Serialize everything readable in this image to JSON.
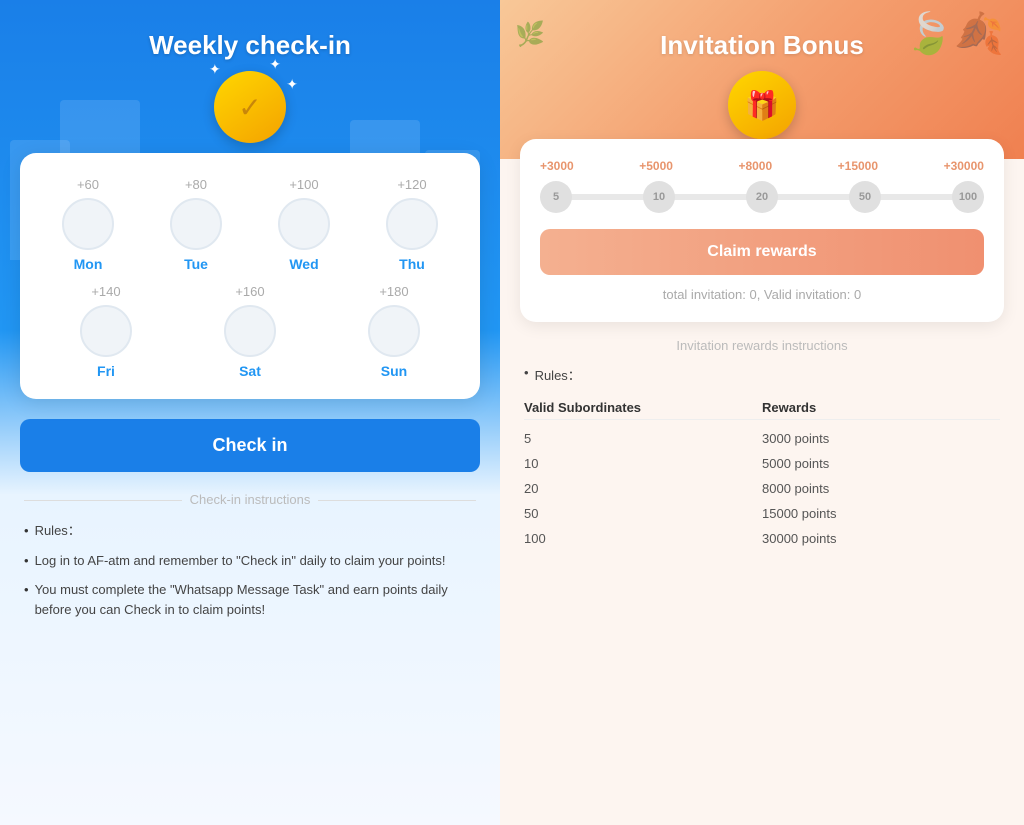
{
  "left": {
    "title": "Weekly check-in",
    "coin_icon": "calendar-check",
    "days": [
      {
        "points": "+60",
        "label": "Mon"
      },
      {
        "points": "+80",
        "label": "Tue"
      },
      {
        "points": "+100",
        "label": "Wed"
      },
      {
        "points": "+120",
        "label": "Thu"
      },
      {
        "points": "+140",
        "label": "Fri"
      },
      {
        "points": "+160",
        "label": "Sat"
      },
      {
        "points": "+180",
        "label": "Sun"
      }
    ],
    "checkin_button": "Check in",
    "instructions_title": "Check-in instructions",
    "rules": [
      "Rules：",
      "Log in to AF-atm and remember to \"Check in\" daily to claim your points!",
      "You must complete the \"Whatsapp Message Task\" and earn points daily before you can Check in to claim points!"
    ]
  },
  "right": {
    "title": "Invitation Bonus",
    "progress_labels": [
      "+3000",
      "+5000",
      "+8000",
      "+15000",
      "+30000"
    ],
    "progress_dots": [
      "5",
      "10",
      "20",
      "50",
      "100"
    ],
    "claim_button": "Claim rewards",
    "stats": "total invitation: 0, Valid invitation: 0",
    "instructions_title": "Invitation rewards instructions",
    "rules": [
      "Rules："
    ],
    "table_header": [
      "Valid Subordinates",
      "Rewards"
    ],
    "table_rows": [
      [
        "5",
        "3000 points"
      ],
      [
        "10",
        "5000 points"
      ],
      [
        "20",
        "8000 points"
      ],
      [
        "50",
        "15000 points"
      ],
      [
        "100",
        "30000 points"
      ]
    ]
  }
}
